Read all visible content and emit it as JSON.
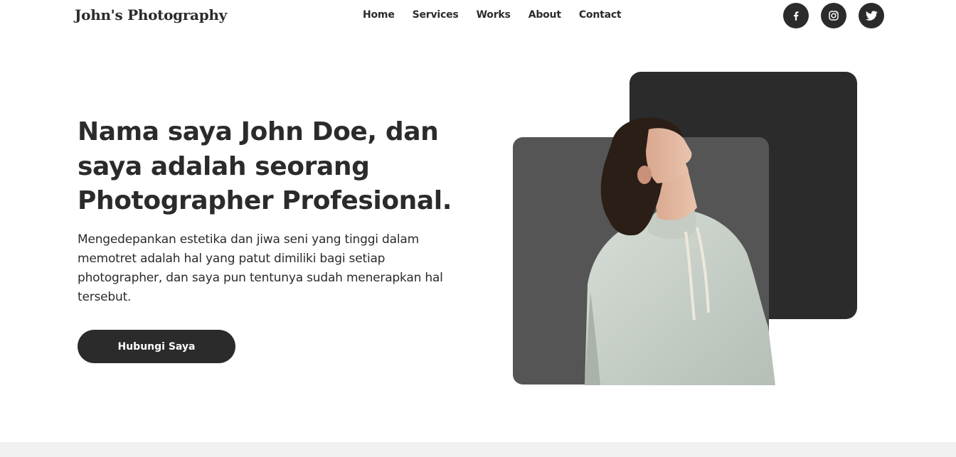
{
  "brand": "John's Photography",
  "nav": {
    "items": [
      {
        "label": "Home"
      },
      {
        "label": "Services"
      },
      {
        "label": "Works"
      },
      {
        "label": "About"
      },
      {
        "label": "Contact"
      }
    ]
  },
  "socials": [
    {
      "icon": "facebook-icon"
    },
    {
      "icon": "instagram-icon"
    },
    {
      "icon": "twitter-icon"
    }
  ],
  "hero": {
    "title": "Nama saya John Doe, dan saya adalah seorang Photographer Profesional.",
    "description": "Mengedepankan estetika dan jiwa seni yang tinggi dalam memotret adalah hal yang patut dimiliki bagi setiap photographer, dan saya pun tentunya sudah menerapkan hal tersebut.",
    "cta_label": "Hubungi Saya"
  },
  "colors": {
    "primary": "#2b2b2b",
    "secondary": "#555555",
    "background": "#ffffff",
    "footer": "#f1f1f1"
  }
}
